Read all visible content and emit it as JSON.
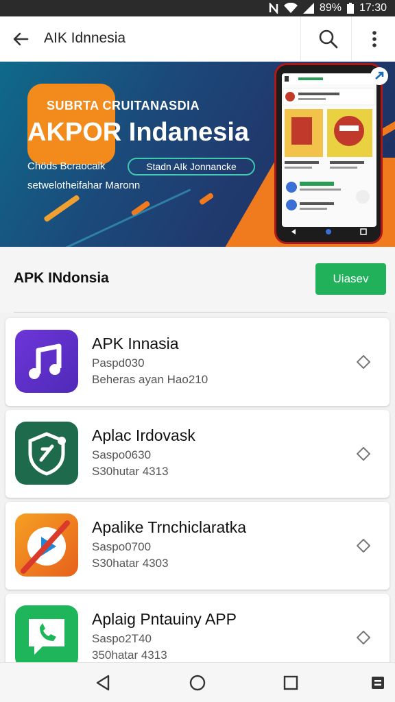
{
  "status_bar": {
    "battery": "89%",
    "time": "17:30",
    "icons": [
      "nfc-icon",
      "wifi-icon",
      "signal-icon",
      "battery-icon"
    ]
  },
  "app_bar": {
    "title": "AIK Idnnesia",
    "icons": [
      "back-arrow-icon",
      "search-icon",
      "more-vert-icon"
    ]
  },
  "banner": {
    "small_title": "SUBRTA CRUITANASDIA",
    "big_title": "AKPOR Indanesia",
    "line1": "Chöds Bcraocaik",
    "pill": "Stadn AIk Jonnancke",
    "line2": "setwelotheifahar Maronn",
    "colors": {
      "background": "#1b4a7a",
      "accent": "#f38a1c",
      "pill_border": "#3ec9b0"
    }
  },
  "section": {
    "title": "APK INdonsia",
    "button_label": "Uiasev",
    "button_color": "#20b15a"
  },
  "apps": [
    {
      "name": "APK Innasia",
      "meta1": "Paspd030",
      "meta2": "Beheras ayan Hao210",
      "icon": "music-note-icon",
      "color": "#5b2fc4"
    },
    {
      "name": "Aplac Irdovask",
      "meta1": "Saspo0630",
      "meta2": "S30hutar 4313",
      "icon": "shield-pin-icon",
      "color": "#1d6b4c"
    },
    {
      "name": "Apalike Trnchiclaratka",
      "meta1": "Saspo0700",
      "meta2": "S30hatar 4303",
      "icon": "play-slash-icon",
      "color": "#f07a1e"
    },
    {
      "name": "Aplaig Pntauiny APP",
      "meta1": "Saspo2T40",
      "meta2": "350hatar 4313",
      "icon": "phone-chat-icon",
      "color": "#1fb55a"
    }
  ],
  "nav_bar": {
    "icons": [
      "nav-back-icon",
      "nav-home-icon",
      "nav-recents-icon",
      "nav-menu-icon"
    ]
  }
}
